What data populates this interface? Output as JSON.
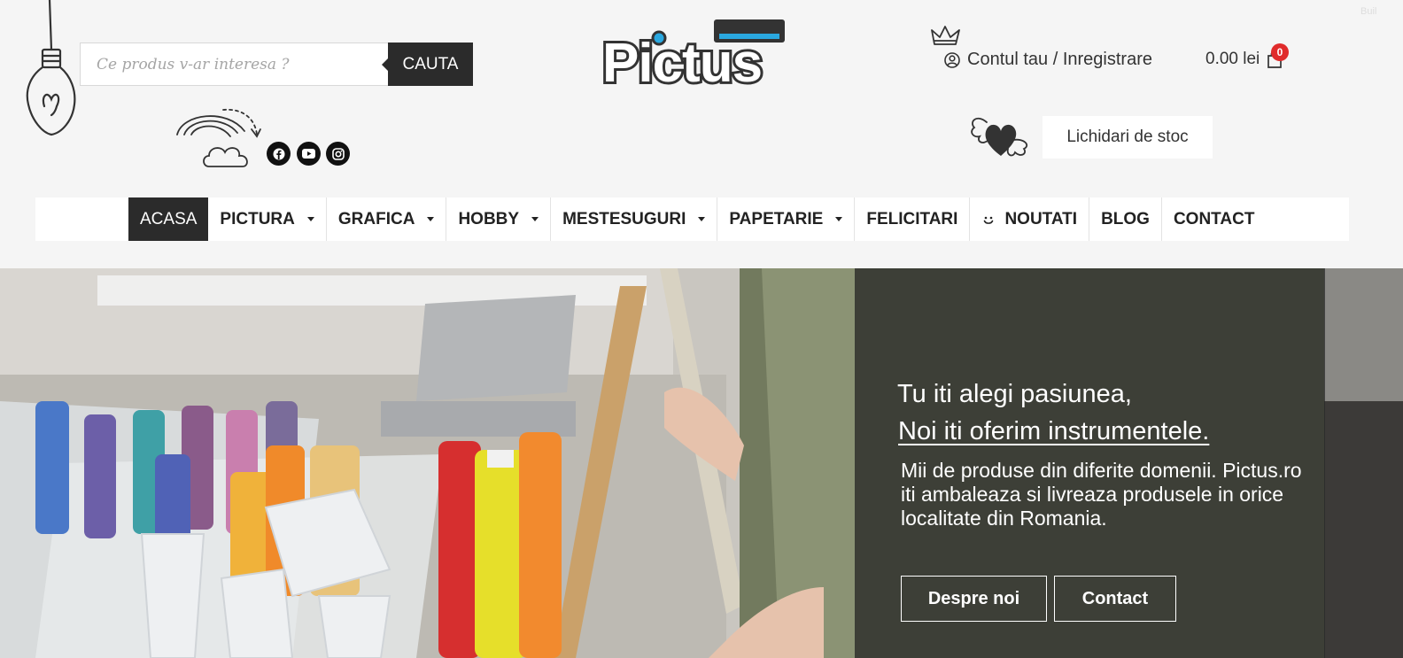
{
  "search": {
    "placeholder": "Ce produs v-ar interesa ?",
    "button_label": "CAUTA"
  },
  "logo": {
    "text": "Pictus"
  },
  "account": {
    "label": "Contul tau / Inregistrare"
  },
  "cart": {
    "total": "0.00 lei",
    "count": "0"
  },
  "stock_button": {
    "label": "Lichidari de stoc"
  },
  "social": [
    "facebook-icon",
    "youtube-icon",
    "instagram-icon"
  ],
  "nav": {
    "items": [
      {
        "label": "ACASA",
        "active": true,
        "dropdown": false
      },
      {
        "label": "PICTURA",
        "dropdown": true
      },
      {
        "label": "GRAFICA",
        "dropdown": true
      },
      {
        "label": "HOBBY",
        "dropdown": true
      },
      {
        "label": "MESTESUGURI",
        "dropdown": true
      },
      {
        "label": "PAPETARIE",
        "dropdown": true
      },
      {
        "label": "FELICITARI",
        "dropdown": false
      },
      {
        "label": "NOUTATI",
        "dropdown": false,
        "icon": "smile-icon"
      },
      {
        "label": "BLOG",
        "dropdown": false
      },
      {
        "label": "CONTACT",
        "dropdown": false
      }
    ]
  },
  "hero": {
    "line1": "Tu iti alegi pasiunea,",
    "line2": "Noi iti oferim instrumentele.",
    "body": "Mii de produse din diferite domenii. Pictus.ro iti ambaleaza si livreaza produsele in orice localitate din Romania.",
    "btn_about": "Despre noi",
    "btn_contact": "Contact"
  },
  "corner_text": "Buil",
  "colors": {
    "accent": "#2aa8e0",
    "dark": "#2b2b2b",
    "badge": "#e02b2b",
    "background": "#f5f5f5"
  }
}
